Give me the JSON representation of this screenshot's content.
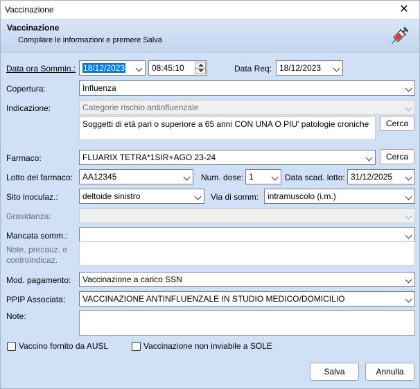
{
  "window": {
    "title": "Vaccinazione",
    "close": "✕"
  },
  "header": {
    "title": "Vaccinazione",
    "subtitle": "Compilare le informazioni e premere Salva",
    "icon": "syringe-icon"
  },
  "form": {
    "data_ora": {
      "label": "Data ora Sommin.:",
      "date": "18/12/2023",
      "time": "08:45:10"
    },
    "data_req": {
      "label": "Data Req:",
      "value": "18/12/2023"
    },
    "copertura": {
      "label": "Copertura:",
      "value": "Influenza"
    },
    "indicazione": {
      "label": "Indicazione:",
      "value": "Categorie rischio antinfluenzale",
      "detail": "Soggetti di età pari o superiore a 65 anni CON UNA O PIU' patologie croniche",
      "search": "Cerca"
    },
    "farmaco": {
      "label": "Farmaco:",
      "value": "FLUARIX TETRA*1SIR+AGO 23-24",
      "search": "Cerca"
    },
    "lotto": {
      "label": "Lotto del farmaco:",
      "value": "AA12345"
    },
    "num_dose": {
      "label": "Num. dose:",
      "value": "1"
    },
    "scad_lotto": {
      "label": "Data scad. lotto:",
      "value": "31/12/2025"
    },
    "sito": {
      "label": "Sito inoculaz.:",
      "value": "deltoide sinistro"
    },
    "via": {
      "label": "Via di somm:",
      "value": "intramuscolo (i.m.)"
    },
    "gravidanza": {
      "label": "Gravidanza:",
      "value": ""
    },
    "mancata": {
      "label": "Mancata somm.:",
      "value": ""
    },
    "note_precauz": {
      "label_l1": "Note, precauz. e",
      "label_l2": "controindicaz.",
      "value": ""
    },
    "mod_pagamento": {
      "label": "Mod. pagamento:",
      "value": "Vaccinazione a carico SSN"
    },
    "ppip": {
      "label": "PPIP Associata:",
      "value": "VACCINAZIONE ANTINFLUENZALE IN STUDIO MEDICO/DOMICILIO"
    },
    "note": {
      "label": "Note:",
      "value": ""
    },
    "chk_ausl": {
      "label": "Vaccino fornito da AUSL",
      "checked": false
    },
    "chk_sole": {
      "label": "Vaccinazione non inviabile a SOLE",
      "checked": false
    }
  },
  "buttons": {
    "save": "Salva",
    "cancel": "Annulla"
  }
}
